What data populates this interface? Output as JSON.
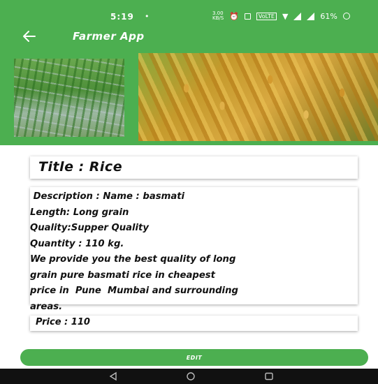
{
  "status_bar": {
    "time": "5:19",
    "dot": "•",
    "data_speed": "3.00",
    "data_unit": "KB/S",
    "volte": "VoLTE",
    "battery": "61%"
  },
  "toolbar": {
    "title": "Farmer App",
    "back_icon": "arrow-left-icon"
  },
  "product": {
    "title": "Title : Rice",
    "description": " Description : Name : basmati\nLength: Long grain\nQuality:Supper Quality\nQuantity : 110 kg.\nWe provide you the best quality of long\ngrain pure basmati rice in cheapest\nprice in  Pune  Mumbai and surrounding\nareas.",
    "price": "Price : 110"
  },
  "actions": {
    "edit_label": "EDIT"
  },
  "colors": {
    "primary": "#4caf50",
    "nav_bar": "#111111"
  }
}
